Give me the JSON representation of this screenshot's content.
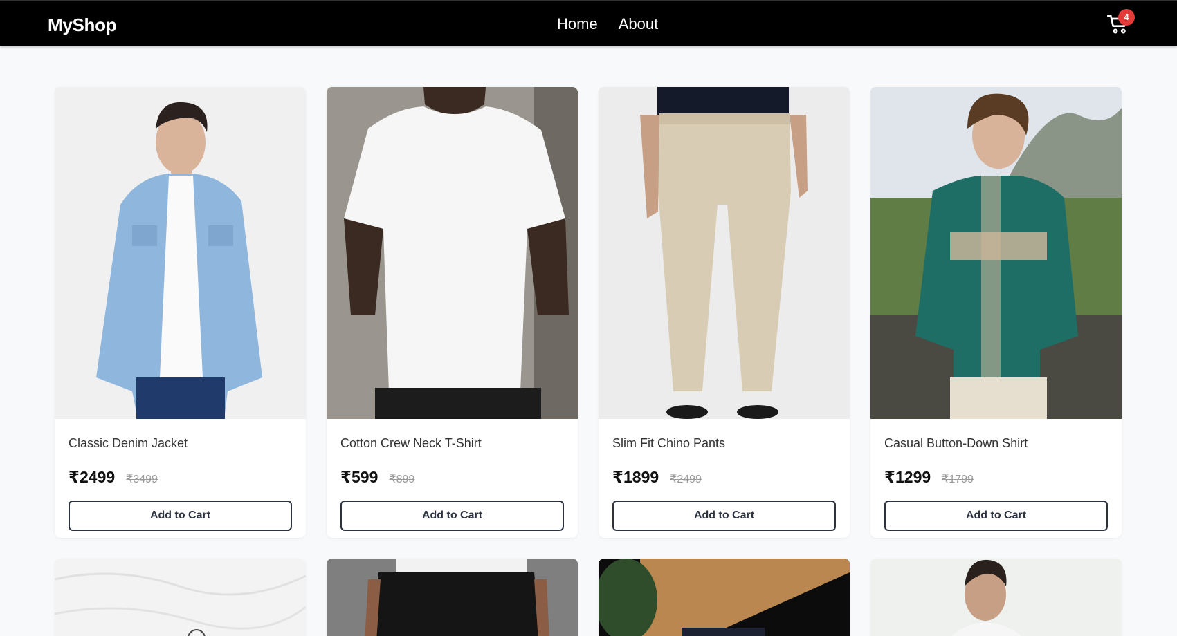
{
  "header": {
    "brand": "MyShop",
    "nav": [
      "Home",
      "About"
    ],
    "cart_count": "4",
    "badge_color": "#e33a3a"
  },
  "products": [
    {
      "name": "Classic Denim Jacket",
      "price": "₹2499",
      "old_price": "₹3499",
      "button": "Add to Cart"
    },
    {
      "name": "Cotton Crew Neck T-Shirt",
      "price": "₹599",
      "old_price": "₹899",
      "button": "Add to Cart"
    },
    {
      "name": "Slim Fit Chino Pants",
      "price": "₹1899",
      "old_price": "₹2499",
      "button": "Add to Cart"
    },
    {
      "name": "Casual Button-Down Shirt",
      "price": "₹1299",
      "old_price": "₹1799",
      "button": "Add to Cart"
    }
  ],
  "icons": {
    "cart": "cart-icon"
  }
}
